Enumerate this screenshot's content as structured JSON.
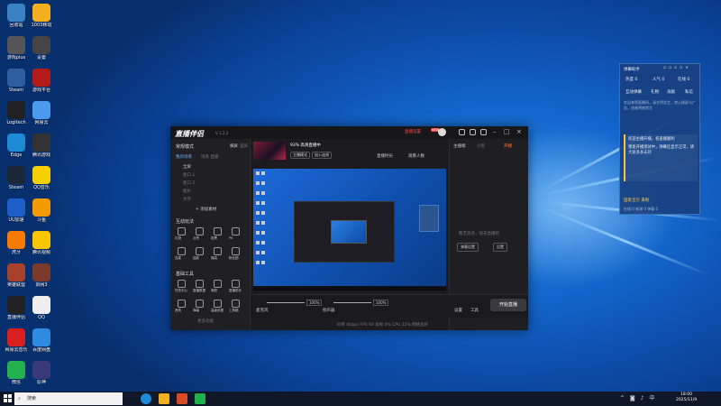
{
  "desktop": {
    "icons": [
      {
        "label": "回收站",
        "color": "#3b82c4"
      },
      {
        "label": "1003移动",
        "color": "#f2b01e"
      },
      {
        "label": "游戏plus",
        "color": "#555555"
      },
      {
        "label": "设置",
        "color": "#444444"
      },
      {
        "label": "Steam",
        "color": "#2d5fa0"
      },
      {
        "label": "游戏平台",
        "color": "#b31b1b"
      },
      {
        "label": "Logitech",
        "color": "#222222"
      },
      {
        "label": "网易云",
        "color": "#4a9bf0"
      },
      {
        "label": "Edge",
        "color": "#1e8ad6"
      },
      {
        "label": "腾讯游戏",
        "color": "#333333"
      },
      {
        "label": "Steam",
        "color": "#1b2838"
      },
      {
        "label": "QQ音乐",
        "color": "#f5d000"
      },
      {
        "label": "UU加速",
        "color": "#1e5ec8"
      },
      {
        "label": "斗鱼",
        "color": "#f29b00"
      },
      {
        "label": "虎牙",
        "color": "#f57a00"
      },
      {
        "label": "腾讯视频",
        "color": "#f7c600"
      },
      {
        "label": "英雄联盟",
        "color": "#a8412c"
      },
      {
        "label": "剑网3",
        "color": "#7a3a2a"
      },
      {
        "label": "直播伴侣",
        "color": "#222222"
      },
      {
        "label": "QQ",
        "color": "#eeeeee"
      },
      {
        "label": "网易云音乐",
        "color": "#d92020"
      },
      {
        "label": "百度网盘",
        "color": "#2f8be0"
      },
      {
        "label": "微信",
        "color": "#22b14c"
      },
      {
        "label": "原神",
        "color": "#3a3a7a"
      }
    ]
  },
  "app": {
    "logo": "直播伴侣",
    "version": "V 1.2.3",
    "live_btn": "直播设置",
    "badge": "NEW",
    "left": {
      "scene_label": "常规模式",
      "tab_a": "横屏",
      "tab_b": "竖屏",
      "my_scene": "我的场景",
      "tabs2": "场景  直播",
      "items": [
        "全屏",
        "窗口 1",
        "窗口 2",
        "图片",
        "文字"
      ],
      "add_btn": "+ 添加素材",
      "interact": "互动玩法",
      "interact_items": [
        "礼物",
        "点赞",
        "投票",
        "PK",
        "连麦",
        "抽奖",
        "福袋",
        "粉丝团"
      ],
      "tools": "基础工具",
      "tools_items": [
        "任务中心",
        "直播数据",
        "美颜",
        "直播助手",
        "音效",
        "弹幕",
        "高级设置",
        "工具箱"
      ],
      "more": "更多功能"
    },
    "middle": {
      "title": "93% 高清直播中",
      "pill_a": "主播模式",
      "pill_b": "加入连线",
      "stat_a": "直播时长",
      "stat_b": "观看人数",
      "tip": "在电脑上开播直播"
    },
    "right": {
      "tabs": [
        "主播端",
        "小窗",
        "开播"
      ],
      "msg": "暂无消息，快去直播吧",
      "btn_a": "弹幕设置",
      "btn_b": "设置"
    },
    "bottom": {
      "mic": "麦克风",
      "mic_val": "100%",
      "spk": "扬声器",
      "spk_val": "100%",
      "btn_a": "设置",
      "btn_b": "工具",
      "start": "开始直播",
      "status": "码率 0kbps   FPS 60   丢帧 0%   CPU 22%   网络良好"
    }
  },
  "chat": {
    "title": "弹幕助手",
    "stats": [
      "热度 0",
      "人气 0",
      "在线 0"
    ],
    "tabs": [
      "互动弹幕",
      "礼物",
      "贡献",
      "私信"
    ],
    "hint": "欢迎来到直播间，请文明发言，禁止刷屏与广告，违者将被禁言",
    "msg1": "欢迎主播开播，祝直播顺利",
    "msg2": "重复开播测试中，弹幕区显示正常，请大家多多支持",
    "user": "国家宝贝 来啦",
    "footer": "在线 0   新增 0   弹幕 0"
  },
  "taskbar": {
    "search": "搜索",
    "time": "18:00",
    "date": "2025/11/9"
  }
}
